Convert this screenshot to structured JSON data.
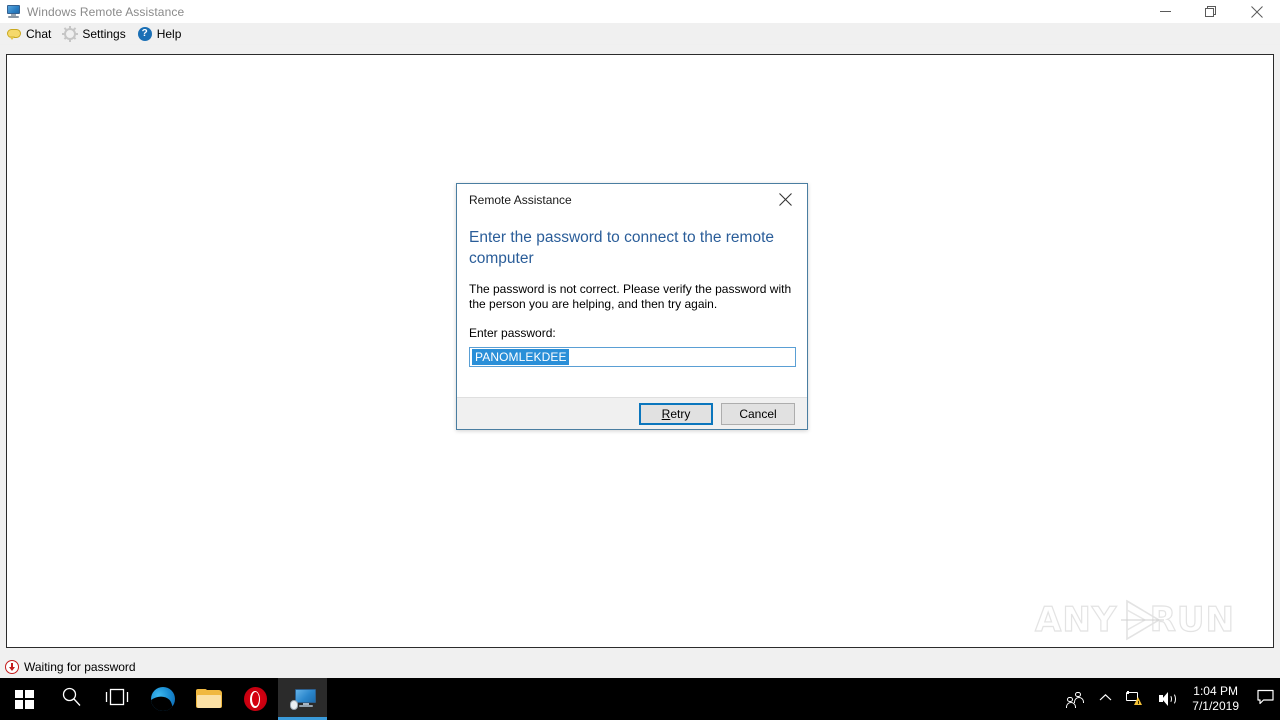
{
  "window": {
    "title": "Windows Remote Assistance",
    "icon": "monitor-icon",
    "controls": {
      "minimize": "minimize-icon",
      "maximize": "restore-icon",
      "close": "close-icon"
    }
  },
  "toolbar": {
    "items": [
      {
        "label": "Chat",
        "icon": "chat-bubble-icon"
      },
      {
        "label": "Settings",
        "icon": "gear-icon"
      },
      {
        "label": "Help",
        "icon": "help-circle-icon"
      }
    ]
  },
  "canvas": {
    "watermark": {
      "left": "ANY",
      "right": "RUN",
      "logo": "play-triangle-icon"
    }
  },
  "statusbar": {
    "icon": "download-arrow-icon",
    "text": "Waiting for password"
  },
  "dialog": {
    "title": "Remote Assistance",
    "close_icon": "close-icon",
    "heading": "Enter the password to connect to the remote computer",
    "message": "The password is not correct. Please verify the password with the person you are helping, and then try again.",
    "field_label": "Enter password:",
    "password": {
      "value": "PANOMLEKDEE",
      "placeholder": "",
      "selected": true
    },
    "buttons": {
      "retry_accesskey": "R",
      "retry_rest": "etry",
      "cancel": "Cancel"
    },
    "colors": {
      "heading": "#2a5d99",
      "border": "#4a7ea1",
      "selection": "#2a8fd8",
      "default_button_border": "#0b76bd"
    }
  },
  "taskbar": {
    "buttons": [
      {
        "name": "start",
        "icon": "windows-logo-icon"
      },
      {
        "name": "search",
        "icon": "magnifier-icon"
      },
      {
        "name": "task-view",
        "icon": "task-view-icon"
      },
      {
        "name": "edge",
        "icon": "edge-browser-icon"
      },
      {
        "name": "file-explorer",
        "icon": "folder-icon"
      },
      {
        "name": "opera",
        "icon": "opera-browser-icon"
      },
      {
        "name": "remote-assistance",
        "icon": "remote-monitor-icon",
        "active": true
      }
    ],
    "tray": {
      "people": "people-icon",
      "chevron": "chevron-up-icon",
      "network": "network-warning-icon",
      "volume": "speaker-icon",
      "time": "1:04 PM",
      "date": "7/1/2019",
      "action_center": "notification-icon"
    }
  }
}
